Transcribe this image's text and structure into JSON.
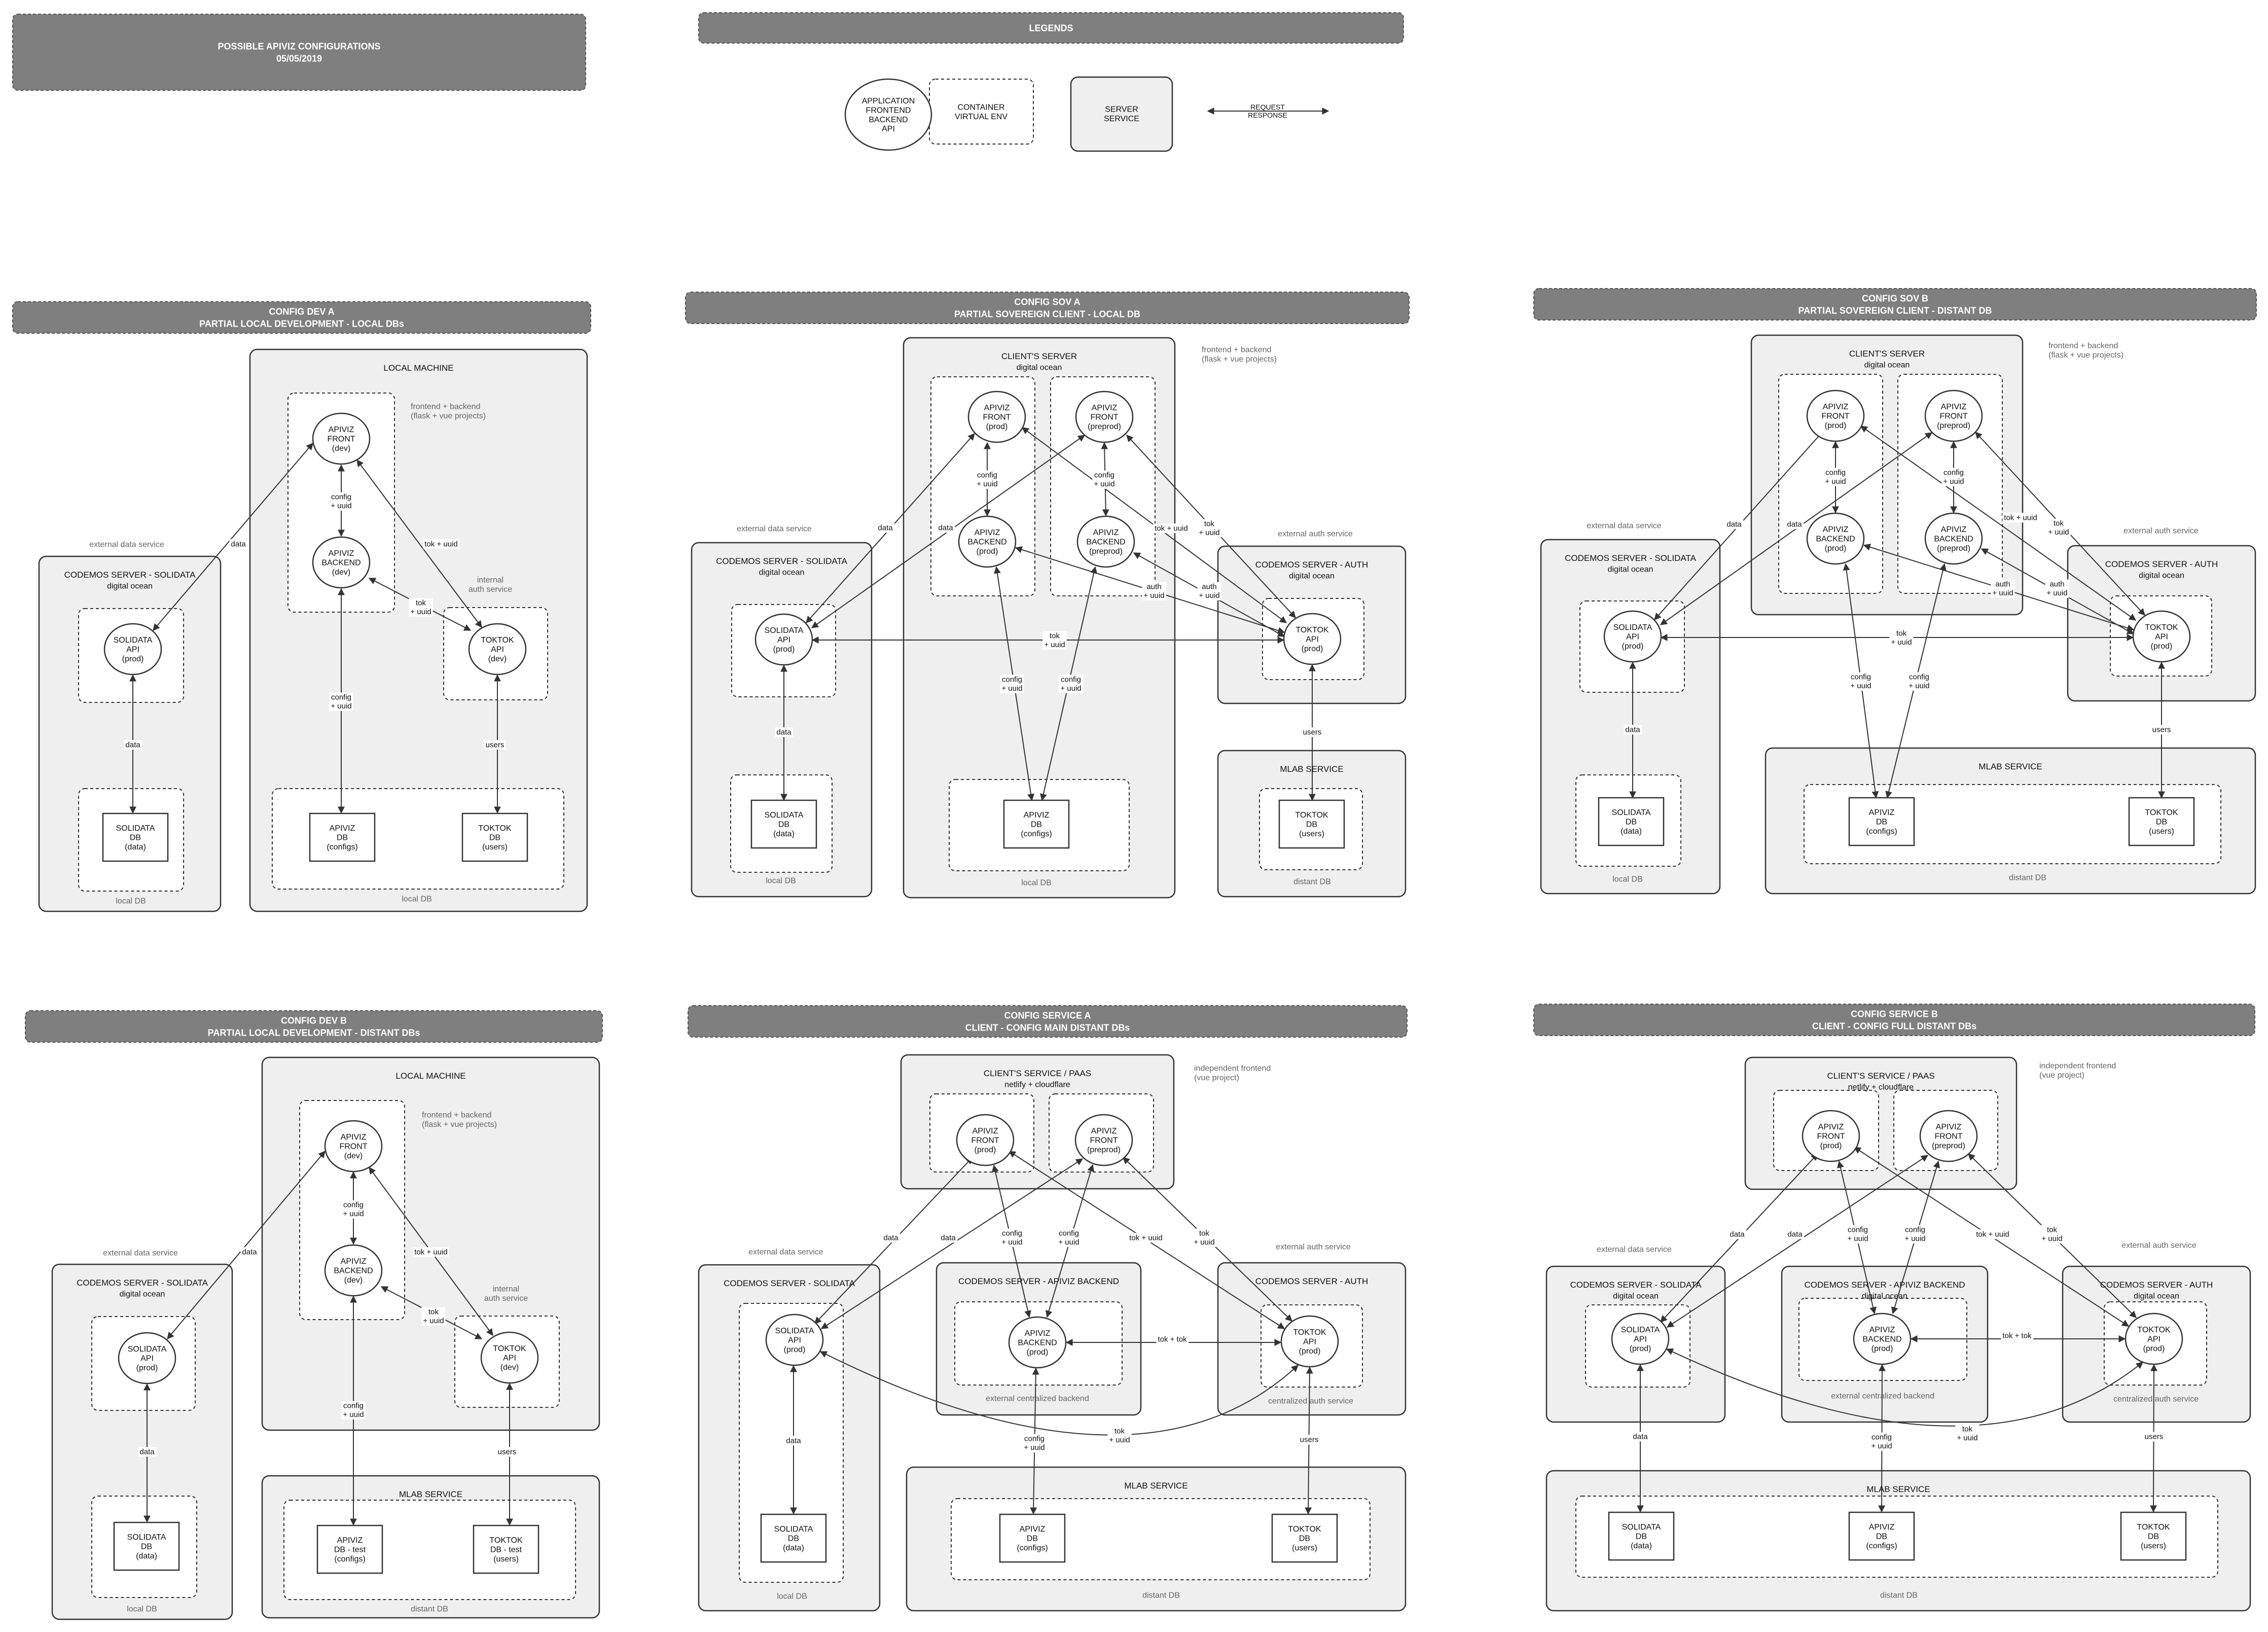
{
  "title": {
    "line1": "POSSIBLE APIVIZ CONFIGURATIONS",
    "line2": "05/05/2019"
  },
  "legends": {
    "header": "LEGENDS",
    "app": [
      "APPLICATION",
      "FRONTEND",
      "BACKEND",
      "API"
    ],
    "container": [
      "CONTAINER",
      "VIRTUAL ENV"
    ],
    "server": [
      "SERVER",
      "SERVICE"
    ],
    "arrow": [
      "REQUEST",
      "RESPONSE"
    ]
  },
  "configs": {
    "dev_a": {
      "title": "CONFIG DEV A",
      "subtitle": "PARTIAL LOCAL DEVELOPMENT - LOCAL DBs"
    },
    "sov_a": {
      "title": "CONFIG SOV A",
      "subtitle": "PARTIAL SOVEREIGN CLIENT - LOCAL DB"
    },
    "sov_b": {
      "title": "CONFIG SOV B",
      "subtitle": "PARTIAL SOVEREIGN CLIENT - DISTANT DB"
    },
    "dev_b": {
      "title": "CONFIG DEV B",
      "subtitle": "PARTIAL LOCAL DEVELOPMENT - DISTANT DBs"
    },
    "service_a": {
      "title": "CONFIG SERVICE A",
      "subtitle": "CLIENT - CONFIG MAIN DISTANT DBs"
    },
    "service_b": {
      "title": "CONFIG SERVICE B",
      "subtitle": "CLIENT - CONFIG FULL DISTANT DBs"
    }
  },
  "servers": {
    "local_machine": "LOCAL MACHINE",
    "solidata_server": "CODEMOS SERVER - SOLIDATA",
    "auth_server": "CODEMOS SERVER - AUTH",
    "backend_server": "CODEMOS SERVER - APIVIZ BACKEND",
    "clients_server": "CLIENT'S SERVER",
    "clients_service": "CLIENT'S SERVICE / PAAS",
    "mlab": "MLAB SERVICE",
    "digital_ocean": "digital ocean",
    "netlify": "netlify + cloudflare"
  },
  "nodes": {
    "front_dev": [
      "APIVIZ",
      "FRONT",
      "(dev)"
    ],
    "backend_dev": [
      "APIVIZ",
      "BACKEND",
      "(dev)"
    ],
    "front_prod": [
      "APIVIZ",
      "FRONT",
      "(prod)"
    ],
    "front_preprod": [
      "APIVIZ",
      "FRONT",
      "(preprod)"
    ],
    "backend_prod": [
      "APIVIZ",
      "BACKEND",
      "(prod)"
    ],
    "backend_preprod": [
      "APIVIZ",
      "BACKEND",
      "(preprod)"
    ],
    "solidata_prod": [
      "SOLIDATA",
      "API",
      "(prod)"
    ],
    "toktok_dev": [
      "TOKTOK",
      "API",
      "(dev)"
    ],
    "toktok_prod": [
      "TOKTOK",
      "API",
      "(prod)"
    ],
    "solidata_db": [
      "SOLIDATA",
      "DB",
      "(data)"
    ],
    "apiviz_db": [
      "APIVIZ",
      "DB",
      "(configs)"
    ],
    "toktok_db": [
      "TOKTOK",
      "DB",
      "(users)"
    ],
    "apiviz_db_test": [
      "APIVIZ",
      "DB - test",
      "(configs)"
    ],
    "toktok_db_test": [
      "TOKTOK",
      "DB - test",
      "(users)"
    ]
  },
  "notes": {
    "frontend_backend": [
      "frontend + backend",
      "(flask + vue projects)"
    ],
    "independent_frontend": [
      "independent frontend",
      "(vue project)"
    ],
    "external_data": "external data service",
    "external_auth": "external auth service",
    "internal_auth": [
      "internal",
      "auth service"
    ],
    "local_db": "local DB",
    "distant_db": "distant DB",
    "ext_backend": "external centralized backend",
    "central_auth": "centralized auth service"
  },
  "labels": {
    "data": "data",
    "users": "users",
    "config_uuid": [
      "config",
      "+ uuid"
    ],
    "tok_uuid": [
      "tok",
      "+ uuid"
    ],
    "tok_uuid_inline": "tok + uuid",
    "tok_tok": "tok + tok",
    "auth_uuid": [
      "auth",
      "+ uuid"
    ]
  },
  "colors": {
    "banner": "#7f7f7f",
    "banner_border": "#555555",
    "server_fill": "#efefef",
    "stroke": "#333333",
    "note_text": "#666666"
  }
}
